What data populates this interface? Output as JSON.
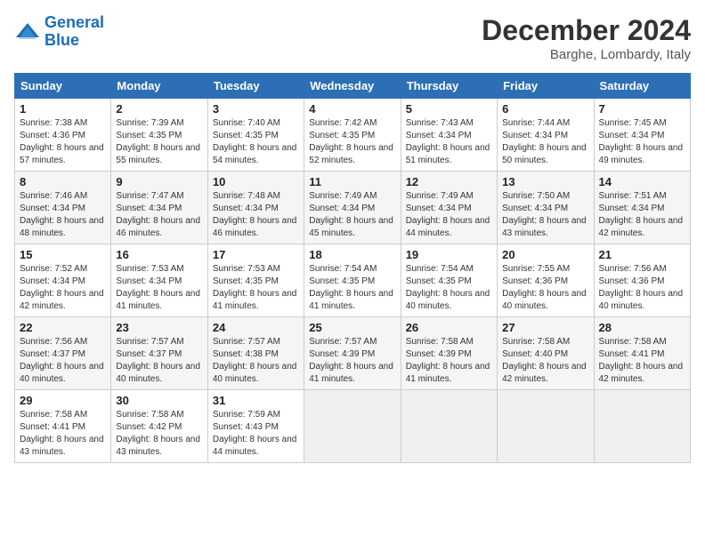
{
  "header": {
    "logo_line1": "General",
    "logo_line2": "Blue",
    "month": "December 2024",
    "location": "Barghe, Lombardy, Italy"
  },
  "days_of_week": [
    "Sunday",
    "Monday",
    "Tuesday",
    "Wednesday",
    "Thursday",
    "Friday",
    "Saturday"
  ],
  "weeks": [
    [
      {
        "day": "1",
        "sunrise": "Sunrise: 7:38 AM",
        "sunset": "Sunset: 4:36 PM",
        "daylight": "Daylight: 8 hours and 57 minutes."
      },
      {
        "day": "2",
        "sunrise": "Sunrise: 7:39 AM",
        "sunset": "Sunset: 4:35 PM",
        "daylight": "Daylight: 8 hours and 55 minutes."
      },
      {
        "day": "3",
        "sunrise": "Sunrise: 7:40 AM",
        "sunset": "Sunset: 4:35 PM",
        "daylight": "Daylight: 8 hours and 54 minutes."
      },
      {
        "day": "4",
        "sunrise": "Sunrise: 7:42 AM",
        "sunset": "Sunset: 4:35 PM",
        "daylight": "Daylight: 8 hours and 52 minutes."
      },
      {
        "day": "5",
        "sunrise": "Sunrise: 7:43 AM",
        "sunset": "Sunset: 4:34 PM",
        "daylight": "Daylight: 8 hours and 51 minutes."
      },
      {
        "day": "6",
        "sunrise": "Sunrise: 7:44 AM",
        "sunset": "Sunset: 4:34 PM",
        "daylight": "Daylight: 8 hours and 50 minutes."
      },
      {
        "day": "7",
        "sunrise": "Sunrise: 7:45 AM",
        "sunset": "Sunset: 4:34 PM",
        "daylight": "Daylight: 8 hours and 49 minutes."
      }
    ],
    [
      {
        "day": "8",
        "sunrise": "Sunrise: 7:46 AM",
        "sunset": "Sunset: 4:34 PM",
        "daylight": "Daylight: 8 hours and 48 minutes."
      },
      {
        "day": "9",
        "sunrise": "Sunrise: 7:47 AM",
        "sunset": "Sunset: 4:34 PM",
        "daylight": "Daylight: 8 hours and 46 minutes."
      },
      {
        "day": "10",
        "sunrise": "Sunrise: 7:48 AM",
        "sunset": "Sunset: 4:34 PM",
        "daylight": "Daylight: 8 hours and 46 minutes."
      },
      {
        "day": "11",
        "sunrise": "Sunrise: 7:49 AM",
        "sunset": "Sunset: 4:34 PM",
        "daylight": "Daylight: 8 hours and 45 minutes."
      },
      {
        "day": "12",
        "sunrise": "Sunrise: 7:49 AM",
        "sunset": "Sunset: 4:34 PM",
        "daylight": "Daylight: 8 hours and 44 minutes."
      },
      {
        "day": "13",
        "sunrise": "Sunrise: 7:50 AM",
        "sunset": "Sunset: 4:34 PM",
        "daylight": "Daylight: 8 hours and 43 minutes."
      },
      {
        "day": "14",
        "sunrise": "Sunrise: 7:51 AM",
        "sunset": "Sunset: 4:34 PM",
        "daylight": "Daylight: 8 hours and 42 minutes."
      }
    ],
    [
      {
        "day": "15",
        "sunrise": "Sunrise: 7:52 AM",
        "sunset": "Sunset: 4:34 PM",
        "daylight": "Daylight: 8 hours and 42 minutes."
      },
      {
        "day": "16",
        "sunrise": "Sunrise: 7:53 AM",
        "sunset": "Sunset: 4:34 PM",
        "daylight": "Daylight: 8 hours and 41 minutes."
      },
      {
        "day": "17",
        "sunrise": "Sunrise: 7:53 AM",
        "sunset": "Sunset: 4:35 PM",
        "daylight": "Daylight: 8 hours and 41 minutes."
      },
      {
        "day": "18",
        "sunrise": "Sunrise: 7:54 AM",
        "sunset": "Sunset: 4:35 PM",
        "daylight": "Daylight: 8 hours and 41 minutes."
      },
      {
        "day": "19",
        "sunrise": "Sunrise: 7:54 AM",
        "sunset": "Sunset: 4:35 PM",
        "daylight": "Daylight: 8 hours and 40 minutes."
      },
      {
        "day": "20",
        "sunrise": "Sunrise: 7:55 AM",
        "sunset": "Sunset: 4:36 PM",
        "daylight": "Daylight: 8 hours and 40 minutes."
      },
      {
        "day": "21",
        "sunrise": "Sunrise: 7:56 AM",
        "sunset": "Sunset: 4:36 PM",
        "daylight": "Daylight: 8 hours and 40 minutes."
      }
    ],
    [
      {
        "day": "22",
        "sunrise": "Sunrise: 7:56 AM",
        "sunset": "Sunset: 4:37 PM",
        "daylight": "Daylight: 8 hours and 40 minutes."
      },
      {
        "day": "23",
        "sunrise": "Sunrise: 7:57 AM",
        "sunset": "Sunset: 4:37 PM",
        "daylight": "Daylight: 8 hours and 40 minutes."
      },
      {
        "day": "24",
        "sunrise": "Sunrise: 7:57 AM",
        "sunset": "Sunset: 4:38 PM",
        "daylight": "Daylight: 8 hours and 40 minutes."
      },
      {
        "day": "25",
        "sunrise": "Sunrise: 7:57 AM",
        "sunset": "Sunset: 4:39 PM",
        "daylight": "Daylight: 8 hours and 41 minutes."
      },
      {
        "day": "26",
        "sunrise": "Sunrise: 7:58 AM",
        "sunset": "Sunset: 4:39 PM",
        "daylight": "Daylight: 8 hours and 41 minutes."
      },
      {
        "day": "27",
        "sunrise": "Sunrise: 7:58 AM",
        "sunset": "Sunset: 4:40 PM",
        "daylight": "Daylight: 8 hours and 42 minutes."
      },
      {
        "day": "28",
        "sunrise": "Sunrise: 7:58 AM",
        "sunset": "Sunset: 4:41 PM",
        "daylight": "Daylight: 8 hours and 42 minutes."
      }
    ],
    [
      {
        "day": "29",
        "sunrise": "Sunrise: 7:58 AM",
        "sunset": "Sunset: 4:41 PM",
        "daylight": "Daylight: 8 hours and 43 minutes."
      },
      {
        "day": "30",
        "sunrise": "Sunrise: 7:58 AM",
        "sunset": "Sunset: 4:42 PM",
        "daylight": "Daylight: 8 hours and 43 minutes."
      },
      {
        "day": "31",
        "sunrise": "Sunrise: 7:59 AM",
        "sunset": "Sunset: 4:43 PM",
        "daylight": "Daylight: 8 hours and 44 minutes."
      },
      null,
      null,
      null,
      null
    ]
  ]
}
